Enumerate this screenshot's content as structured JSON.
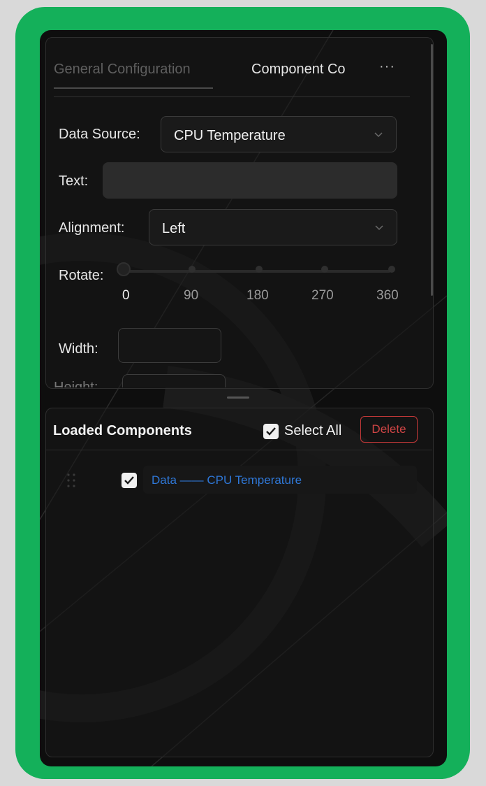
{
  "tabs": {
    "general": "General Configuration",
    "component": "Component Co",
    "more": "···"
  },
  "form": {
    "data_source_label": "Data Source:",
    "data_source_value": "CPU Temperature",
    "text_label": "Text:",
    "text_value": "",
    "alignment_label": "Alignment:",
    "alignment_value": "Left",
    "rotate_label": "Rotate:",
    "rotate_ticks": [
      "0",
      "90",
      "180",
      "270",
      "360"
    ],
    "rotate_value": 0,
    "width_label": "Width:",
    "height_label_partial": "Height:"
  },
  "loaded": {
    "title": "Loaded Components",
    "select_all": "Select All",
    "delete": "Delete",
    "items": [
      {
        "label": "Data —— CPU Temperature",
        "checked": true
      }
    ]
  },
  "colors": {
    "frame": "#14b05a",
    "link": "#2f78d8",
    "danger": "#d04545"
  }
}
